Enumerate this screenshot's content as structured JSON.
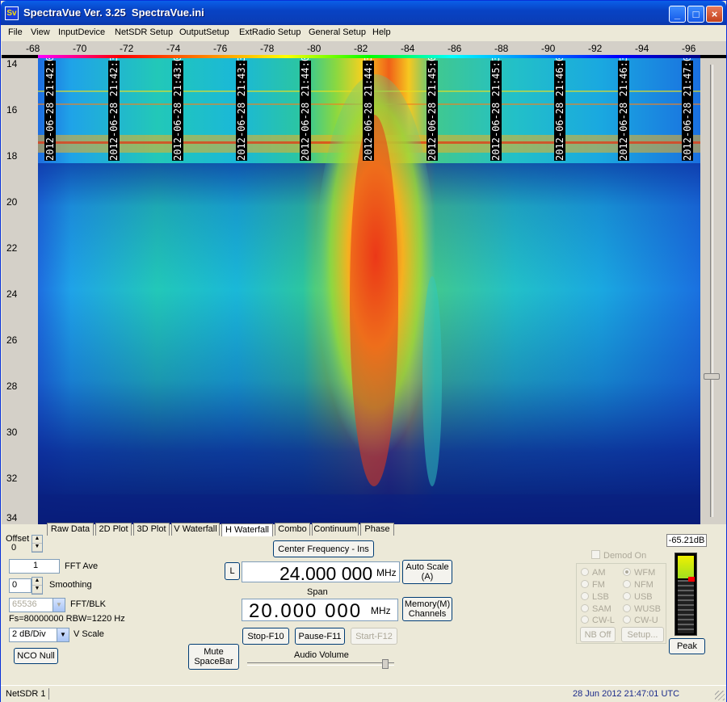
{
  "window": {
    "app_icon": "Sv",
    "title": "SpectraVue Ver. 3.25  SpectraVue.ini",
    "min_label": "_",
    "max_label": "□",
    "close_label": "×"
  },
  "menu": [
    "File",
    "View",
    "InputDevice",
    "NetSDR Setup",
    "OutputSetup",
    "ExtRadio Setup",
    "General Setup",
    "Help"
  ],
  "plot": {
    "x_ticks": [
      "-68",
      "-70",
      "-72",
      "-74",
      "-76",
      "-78",
      "-80",
      "-82",
      "-84",
      "-86",
      "-88",
      "-90",
      "-92",
      "-94",
      "-96"
    ],
    "y_ticks": [
      "14",
      "16",
      "18",
      "20",
      "22",
      "24",
      "26",
      "28",
      "30",
      "32",
      "34"
    ],
    "timestamps": [
      "2012-06-28 21:42:00",
      "2012-06-28 21:42:30",
      "2012-06-28 21:43:00",
      "2012-06-28 21:43:30",
      "2012-06-28 21:44:00",
      "2012-06-28 21:44:30",
      "2012-06-28 21:45:00",
      "2012-06-28 21:45:30",
      "2012-06-28 21:46:00",
      "2012-06-28 21:46:30",
      "2012-06-28 21:47:00"
    ]
  },
  "tabs": [
    "Raw Data",
    "2D Plot",
    "3D Plot",
    "V Waterfall",
    "H Waterfall",
    "Combo",
    "Continuum",
    "Phase"
  ],
  "active_tab": "H Waterfall",
  "controls": {
    "offset_label": "Offset",
    "offset_value": "0",
    "fft_ave_value": "1",
    "fft_ave_label": "FFT Ave",
    "smoothing_value": "0",
    "smoothing_label": "Smoothing",
    "fft_blk_value": "65536",
    "fft_blk_label": "FFT/BLK",
    "fs_rbw": "Fs=80000000 RBW=1220 Hz",
    "vscale_value": "2 dB/Div",
    "vscale_label": "V Scale",
    "nco_null": "NCO Null",
    "mute": "Mute",
    "mute2": "SpaceBar",
    "center_freq_button": "Center Frequency - Ins",
    "l_button": "L",
    "center_freq": "24.000 000",
    "center_unit": "MHz",
    "span_label": "Span",
    "span_value": "20.000 000",
    "span_unit": "MHz",
    "auto_scale": "Auto Scale",
    "auto_scale2": "(A)",
    "memory": "Memory(M)",
    "memory2": "Channels",
    "stop": "Stop-F10",
    "pause": "Pause-F11",
    "start": "Start-F12",
    "audio_volume": "Audio Volume",
    "audio_volume_level": 0.94,
    "demod_on": "Demod On",
    "modes": [
      "AM",
      "WFM",
      "FM",
      "NFM",
      "LSB",
      "USB",
      "SAM",
      "WUSB",
      "CW-L",
      "CW-U"
    ],
    "selected_mode": "WFM",
    "nb_off": "NB Off",
    "setup": "Setup...",
    "level": "-65.21dB",
    "peak": "Peak"
  },
  "status": {
    "device": "NetSDR 1",
    "datetime": "28 Jun 2012  21:47:01 UTC"
  }
}
